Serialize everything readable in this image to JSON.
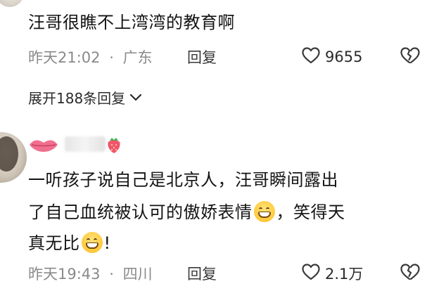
{
  "comment1": {
    "text": "汪哥很瞧不上湾湾的教育啊",
    "time": "昨天21:02",
    "separator": "·",
    "location": "广东",
    "reply_label": "回复",
    "likes": "9655",
    "expand_replies": "展开188条回复"
  },
  "comment2": {
    "text_line1": "一听孩子说自己是北京人，汪哥瞬间露出",
    "text_line2a": "了自己血统被认可的傲娇表情",
    "text_line2b": "，笑得天",
    "text_line3a": "真无比",
    "text_line3b": "!",
    "time": "昨天19:43",
    "separator": "·",
    "location": "四川",
    "reply_label": "回复",
    "likes": "2.1万"
  },
  "icons": {
    "like": "heart-outline-icon",
    "dislike": "broken-heart-icon",
    "expand": "chevron-down-icon",
    "emoji": "grinning-face-emoji",
    "badge_lips": "lips-icon",
    "badge_strawberry": "strawberry-icon"
  },
  "colors": {
    "text": "#141414",
    "meta": "#8a8a8a",
    "lips": "#f06f8f",
    "strawberry": "#f0556b"
  }
}
